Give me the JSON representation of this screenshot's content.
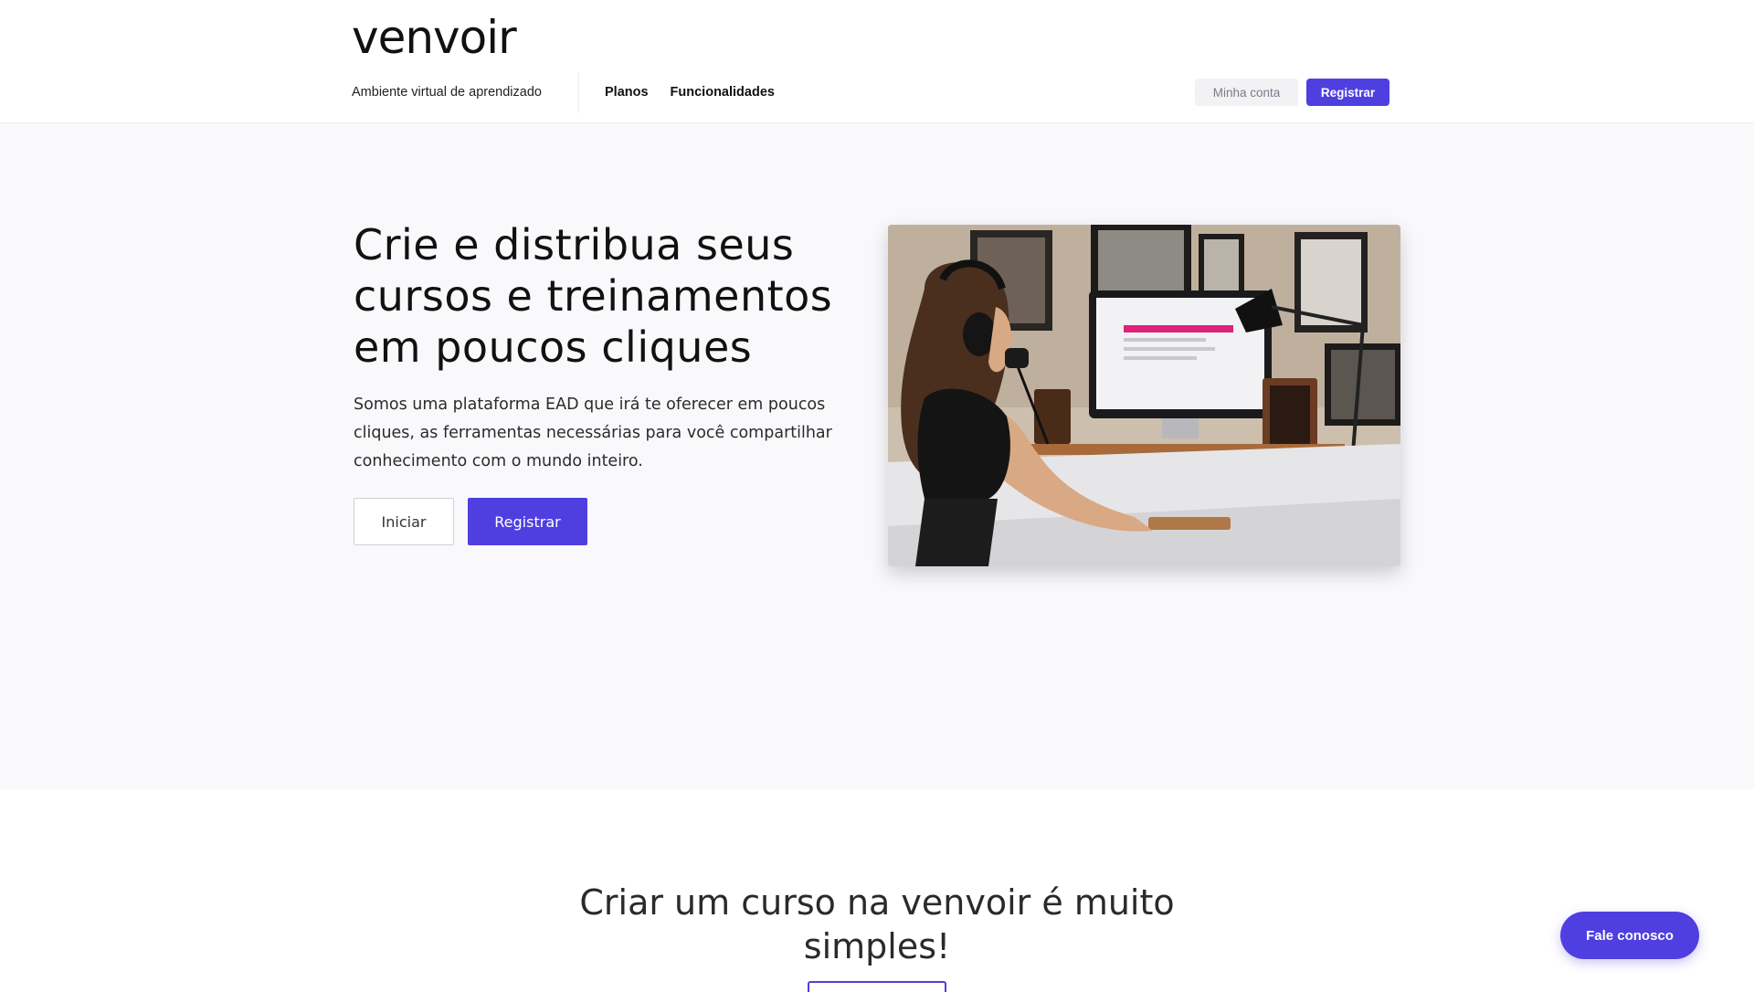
{
  "header": {
    "logo": "venvoir",
    "tagline": "Ambiente virtual de aprendizado",
    "nav": [
      {
        "label": "Planos"
      },
      {
        "label": "Funcionalidades"
      }
    ],
    "account_label": "Minha conta",
    "register_label": "Registrar"
  },
  "hero": {
    "title": "Crie e distribua seus cursos e treinamentos em poucos cliques",
    "description": "Somos uma plataforma EAD que irá te oferecer em poucos cliques, as ferramentas necessárias para você compartilhar conhecimento com o mundo inteiro.",
    "start_label": "Iniciar",
    "register_label": "Registrar"
  },
  "section2": {
    "title": "Criar um curso na venvoir é muito simples!"
  },
  "contact": {
    "label": "Fale conosco"
  },
  "colors": {
    "accent": "#4f3fe0",
    "hero_bg": "#f9f9fc"
  }
}
